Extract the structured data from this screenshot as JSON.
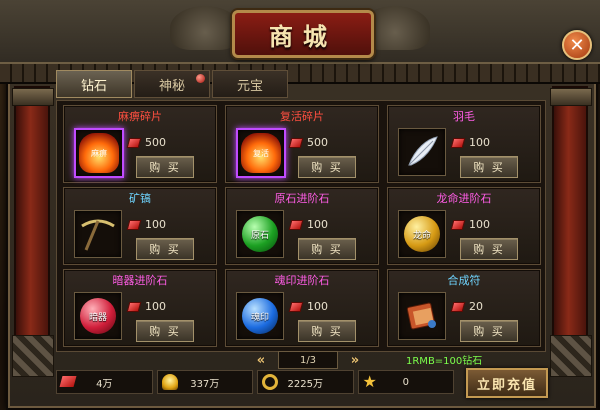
{
  "title": "商城",
  "tabs": [
    {
      "label": "钻石",
      "active": true
    },
    {
      "label": "神秘",
      "active": false,
      "has_dot": true
    },
    {
      "label": "元宝",
      "active": false
    }
  ],
  "items": [
    {
      "name": "麻痹碎片",
      "price": "500",
      "buy_label": "购 买",
      "icon": "fire-relic-icon",
      "icon_text": "麻痹",
      "color": "#ff4f40"
    },
    {
      "name": "复活碎片",
      "price": "500",
      "buy_label": "购 买",
      "icon": "fire-relic-icon",
      "icon_text": "复活",
      "color": "#ff4f40"
    },
    {
      "name": "羽毛",
      "price": "100",
      "buy_label": "购 买",
      "icon": "feather-icon",
      "icon_text": "",
      "color": "#ff5de6"
    },
    {
      "name": "矿镐",
      "price": "100",
      "buy_label": "购 买",
      "icon": "pickaxe-icon",
      "icon_text": "",
      "color": "#6fd5ff"
    },
    {
      "name": "原石进阶石",
      "price": "100",
      "buy_label": "购 买",
      "icon": "green-orb-icon",
      "icon_text": "原石",
      "color": "#ff5de6"
    },
    {
      "name": "龙命进阶石",
      "price": "100",
      "buy_label": "购 买",
      "icon": "gold-orb-icon",
      "icon_text": "龙命",
      "color": "#ff5de6"
    },
    {
      "name": "暗器进阶石",
      "price": "100",
      "buy_label": "购 买",
      "icon": "red-orb-icon",
      "icon_text": "暗器",
      "color": "#ff5de6"
    },
    {
      "name": "魂印进阶石",
      "price": "100",
      "buy_label": "购 买",
      "icon": "blue-orb-icon",
      "icon_text": "魂印",
      "color": "#ff5de6"
    },
    {
      "name": "合成符",
      "price": "20",
      "buy_label": "购 买",
      "icon": "scroll-icon",
      "icon_text": "",
      "color": "#6fd5ff"
    }
  ],
  "pager": {
    "prev": "«",
    "next": "»",
    "page": "1/3"
  },
  "rate": "1RMB=100钻石",
  "currencies": [
    {
      "icon": "diamond-icon",
      "value": "4万"
    },
    {
      "icon": "gold-ingot-icon",
      "value": "337万"
    },
    {
      "icon": "gold-ring-icon",
      "value": "2225万"
    },
    {
      "icon": "star-icon",
      "value": "0"
    }
  ],
  "recharge_label": "立即充值",
  "close_label": "✕"
}
